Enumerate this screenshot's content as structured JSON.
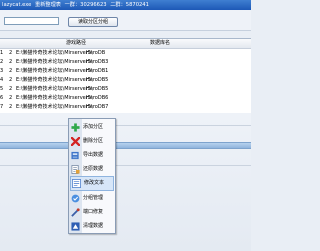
{
  "window": {
    "exe": "lazycat.exe",
    "title": "重新整理表",
    "qq1": "一群：30296623",
    "qq2": "二群：5870241"
  },
  "toolbar": {
    "read_button": "读取分区分组"
  },
  "grid": {
    "headers": {
      "path": "游戏路径",
      "db": "数据库名"
    },
    "rows": [
      {
        "id": "1",
        "sel": "2",
        "path": "E:\\懒猫传奇技术论坛\\Mirserver5\\",
        "db": "HeroDB"
      },
      {
        "id": "2",
        "sel": "2",
        "path": "E:\\懒猫传奇技术论坛\\Mirserver5\\",
        "db": "HeroDB3"
      },
      {
        "id": "3",
        "sel": "2",
        "path": "E:\\懒猫传奇技术论坛\\Mirserver5\\",
        "db": "HeroDB1"
      },
      {
        "id": "4",
        "sel": "2",
        "path": "E:\\懒猫传奇技术论坛\\Mirserver5\\",
        "db": "HeroDB5"
      },
      {
        "id": "5",
        "sel": "2",
        "path": "E:\\懒猫传奇技术论坛\\Mirserver5\\",
        "db": "HeroDB5"
      },
      {
        "id": "6",
        "sel": "2",
        "path": "E:\\懒猫传奇技术论坛\\Mirserver5\\",
        "db": "HeroDB6"
      },
      {
        "id": "7",
        "sel": "2",
        "path": "E:\\懒猫传奇技术论坛\\Mirserver5\\",
        "db": "HeroDB7"
      }
    ]
  },
  "context_menu": {
    "items": [
      {
        "label": "添加分区",
        "icon": "plus-icon"
      },
      {
        "label": "删除分区",
        "icon": "delete-icon"
      },
      {
        "label": "导出数据",
        "icon": "export-icon"
      },
      {
        "label": "还原数据",
        "icon": "restore-icon"
      },
      {
        "label": "修改文本",
        "icon": "edit-text-icon"
      },
      {
        "label": "分组管理",
        "icon": "group-icon"
      },
      {
        "label": "端口修复",
        "icon": "port-repair-icon"
      },
      {
        "label": "清理数据",
        "icon": "clean-icon"
      }
    ],
    "active_index": 4
  },
  "colors": {
    "title": "#2a67c4",
    "selection": "#a8c6e8",
    "accent": "#2ea84a",
    "delete": "#d32222"
  }
}
